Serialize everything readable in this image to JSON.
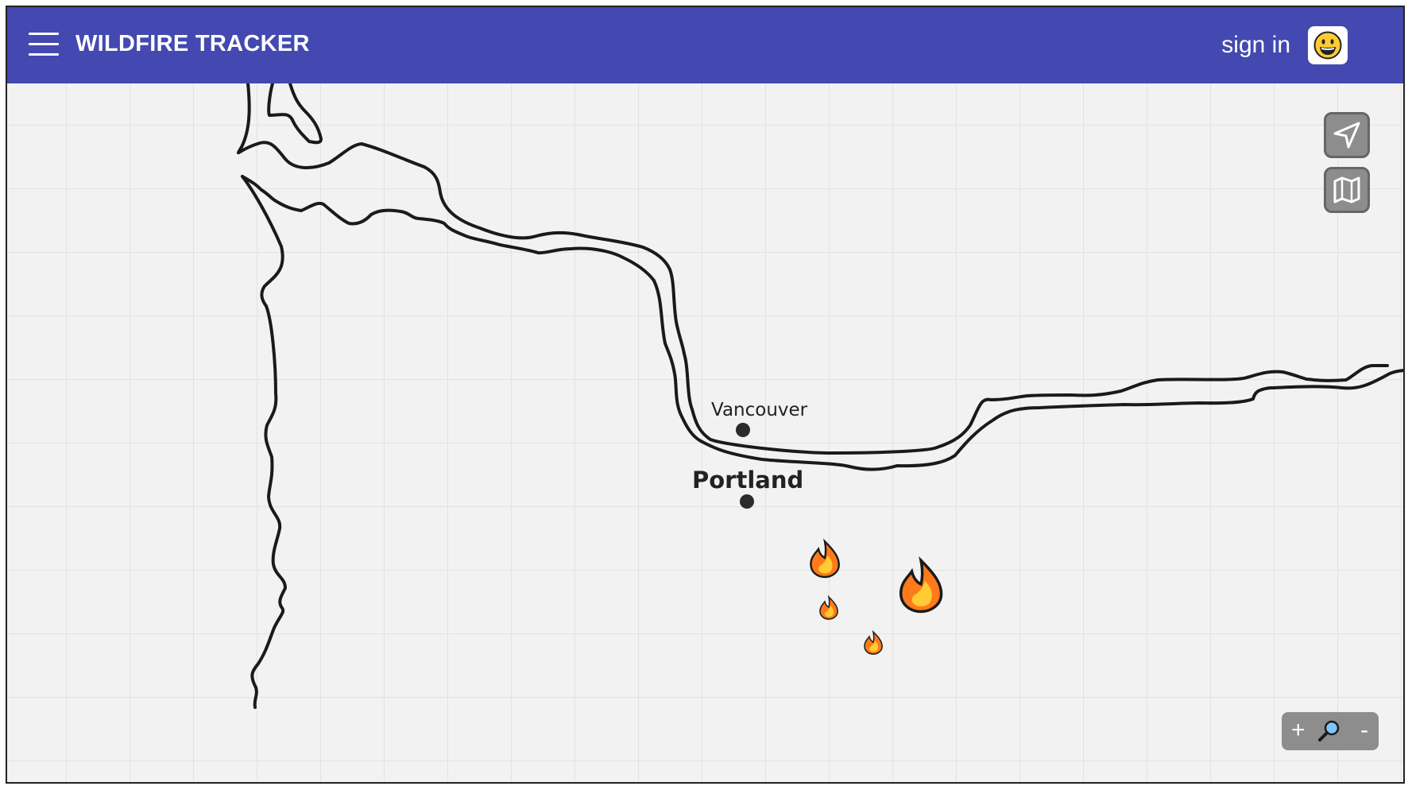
{
  "header": {
    "title": "WILDFIRE TRACKER",
    "signin_label": "sign in",
    "menu_icon": "hamburger-menu-icon",
    "avatar_icon": "grinning-face-icon",
    "bar_color": "#4349b1"
  },
  "map": {
    "cities": [
      {
        "name": "Vancouver",
        "emphasis": "normal"
      },
      {
        "name": "Portland",
        "emphasis": "bold"
      }
    ],
    "fires": [
      {
        "icon": "fire-icon",
        "size": "medium"
      },
      {
        "icon": "fire-icon",
        "size": "large"
      },
      {
        "icon": "fire-icon",
        "size": "small"
      },
      {
        "icon": "fire-icon",
        "size": "small"
      }
    ],
    "controls": {
      "locate_icon": "navigation-arrow-icon",
      "layers_icon": "map-icon",
      "zoom_in_label": "+",
      "zoom_out_label": "-",
      "zoom_icon": "magnifier-icon"
    }
  }
}
